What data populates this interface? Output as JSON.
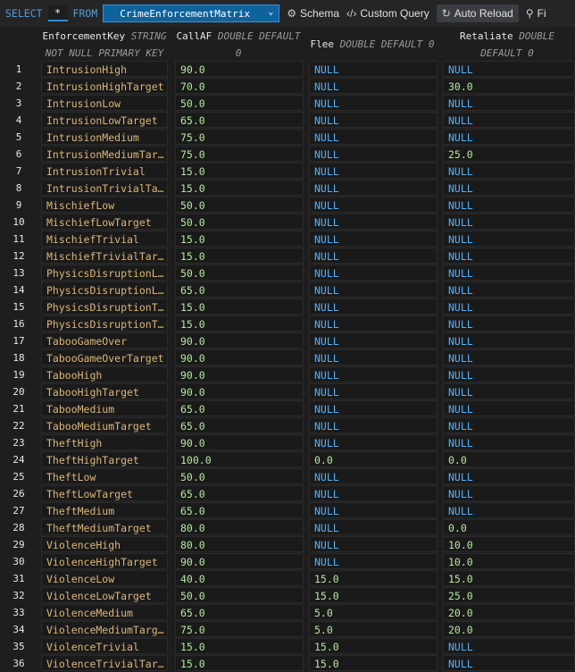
{
  "toolbar": {
    "select_kw": "SELECT",
    "star": "*",
    "from_kw": "FROM",
    "table": "CrimeEnforcementMatrix",
    "schema_label": "Schema",
    "custom_query_label": "Custom Query",
    "auto_reload_label": "Auto Reload",
    "filter_label": "Fi"
  },
  "columns": [
    {
      "name": "EnforcementKey",
      "type_line1": "STRING",
      "type_line2": "NOT NULL PRIMARY KEY"
    },
    {
      "name": "CallAF",
      "type_line1": "DOUBLE DEFAULT",
      "type_line2": "0"
    },
    {
      "name": "Flee",
      "type_line1": "DOUBLE DEFAULT 0",
      "type_line2": ""
    },
    {
      "name": "Retaliate",
      "type_line1": "DOUBLE",
      "type_line2": "DEFAULT 0"
    }
  ],
  "rows": [
    {
      "n": "1",
      "key": "IntrusionHigh",
      "callaf": "90.0",
      "flee": "NULL",
      "retaliate": "NULL"
    },
    {
      "n": "2",
      "key": "IntrusionHighTarget",
      "callaf": "70.0",
      "flee": "NULL",
      "retaliate": "30.0"
    },
    {
      "n": "3",
      "key": "IntrusionLow",
      "callaf": "50.0",
      "flee": "NULL",
      "retaliate": "NULL"
    },
    {
      "n": "4",
      "key": "IntrusionLowTarget",
      "callaf": "65.0",
      "flee": "NULL",
      "retaliate": "NULL"
    },
    {
      "n": "5",
      "key": "IntrusionMedium",
      "callaf": "75.0",
      "flee": "NULL",
      "retaliate": "NULL"
    },
    {
      "n": "6",
      "key": "IntrusionMediumTar…",
      "callaf": "75.0",
      "flee": "NULL",
      "retaliate": "25.0"
    },
    {
      "n": "7",
      "key": "IntrusionTrivial",
      "callaf": "15.0",
      "flee": "NULL",
      "retaliate": "NULL"
    },
    {
      "n": "8",
      "key": "IntrusionTrivialTa…",
      "callaf": "15.0",
      "flee": "NULL",
      "retaliate": "NULL"
    },
    {
      "n": "9",
      "key": "MischiefLow",
      "callaf": "50.0",
      "flee": "NULL",
      "retaliate": "NULL"
    },
    {
      "n": "10",
      "key": "MischiefLowTarget",
      "callaf": "50.0",
      "flee": "NULL",
      "retaliate": "NULL"
    },
    {
      "n": "11",
      "key": "MischiefTrivial",
      "callaf": "15.0",
      "flee": "NULL",
      "retaliate": "NULL"
    },
    {
      "n": "12",
      "key": "MischiefTrivialTar…",
      "callaf": "15.0",
      "flee": "NULL",
      "retaliate": "NULL"
    },
    {
      "n": "13",
      "key": "PhysicsDisruptionL…",
      "callaf": "50.0",
      "flee": "NULL",
      "retaliate": "NULL"
    },
    {
      "n": "14",
      "key": "PhysicsDisruptionL…",
      "callaf": "65.0",
      "flee": "NULL",
      "retaliate": "NULL"
    },
    {
      "n": "15",
      "key": "PhysicsDisruptionT…",
      "callaf": "15.0",
      "flee": "NULL",
      "retaliate": "NULL"
    },
    {
      "n": "16",
      "key": "PhysicsDisruptionT…",
      "callaf": "15.0",
      "flee": "NULL",
      "retaliate": "NULL"
    },
    {
      "n": "17",
      "key": "TabooGameOver",
      "callaf": "90.0",
      "flee": "NULL",
      "retaliate": "NULL"
    },
    {
      "n": "18",
      "key": "TabooGameOverTarget",
      "callaf": "90.0",
      "flee": "NULL",
      "retaliate": "NULL"
    },
    {
      "n": "19",
      "key": "TabooHigh",
      "callaf": "90.0",
      "flee": "NULL",
      "retaliate": "NULL"
    },
    {
      "n": "20",
      "key": "TabooHighTarget",
      "callaf": "90.0",
      "flee": "NULL",
      "retaliate": "NULL"
    },
    {
      "n": "21",
      "key": "TabooMedium",
      "callaf": "65.0",
      "flee": "NULL",
      "retaliate": "NULL"
    },
    {
      "n": "22",
      "key": "TabooMediumTarget",
      "callaf": "65.0",
      "flee": "NULL",
      "retaliate": "NULL"
    },
    {
      "n": "23",
      "key": "TheftHigh",
      "callaf": "90.0",
      "flee": "NULL",
      "retaliate": "NULL"
    },
    {
      "n": "24",
      "key": "TheftHighTarget",
      "callaf": "100.0",
      "flee": "0.0",
      "retaliate": "0.0"
    },
    {
      "n": "25",
      "key": "TheftLow",
      "callaf": "50.0",
      "flee": "NULL",
      "retaliate": "NULL"
    },
    {
      "n": "26",
      "key": "TheftLowTarget",
      "callaf": "65.0",
      "flee": "NULL",
      "retaliate": "NULL"
    },
    {
      "n": "27",
      "key": "TheftMedium",
      "callaf": "65.0",
      "flee": "NULL",
      "retaliate": "NULL"
    },
    {
      "n": "28",
      "key": "TheftMediumTarget",
      "callaf": "80.0",
      "flee": "NULL",
      "retaliate": "0.0"
    },
    {
      "n": "29",
      "key": "ViolenceHigh",
      "callaf": "80.0",
      "flee": "NULL",
      "retaliate": "10.0"
    },
    {
      "n": "30",
      "key": "ViolenceHighTarget",
      "callaf": "90.0",
      "flee": "NULL",
      "retaliate": "10.0"
    },
    {
      "n": "31",
      "key": "ViolenceLow",
      "callaf": "40.0",
      "flee": "15.0",
      "retaliate": "15.0"
    },
    {
      "n": "32",
      "key": "ViolenceLowTarget",
      "callaf": "50.0",
      "flee": "15.0",
      "retaliate": "25.0"
    },
    {
      "n": "33",
      "key": "ViolenceMedium",
      "callaf": "65.0",
      "flee": "5.0",
      "retaliate": "20.0"
    },
    {
      "n": "34",
      "key": "ViolenceMediumTarg…",
      "callaf": "75.0",
      "flee": "5.0",
      "retaliate": "20.0"
    },
    {
      "n": "35",
      "key": "ViolenceTrivial",
      "callaf": "15.0",
      "flee": "15.0",
      "retaliate": "NULL"
    },
    {
      "n": "36",
      "key": "ViolenceTrivialTar…",
      "callaf": "15.0",
      "flee": "15.0",
      "retaliate": "NULL"
    }
  ]
}
